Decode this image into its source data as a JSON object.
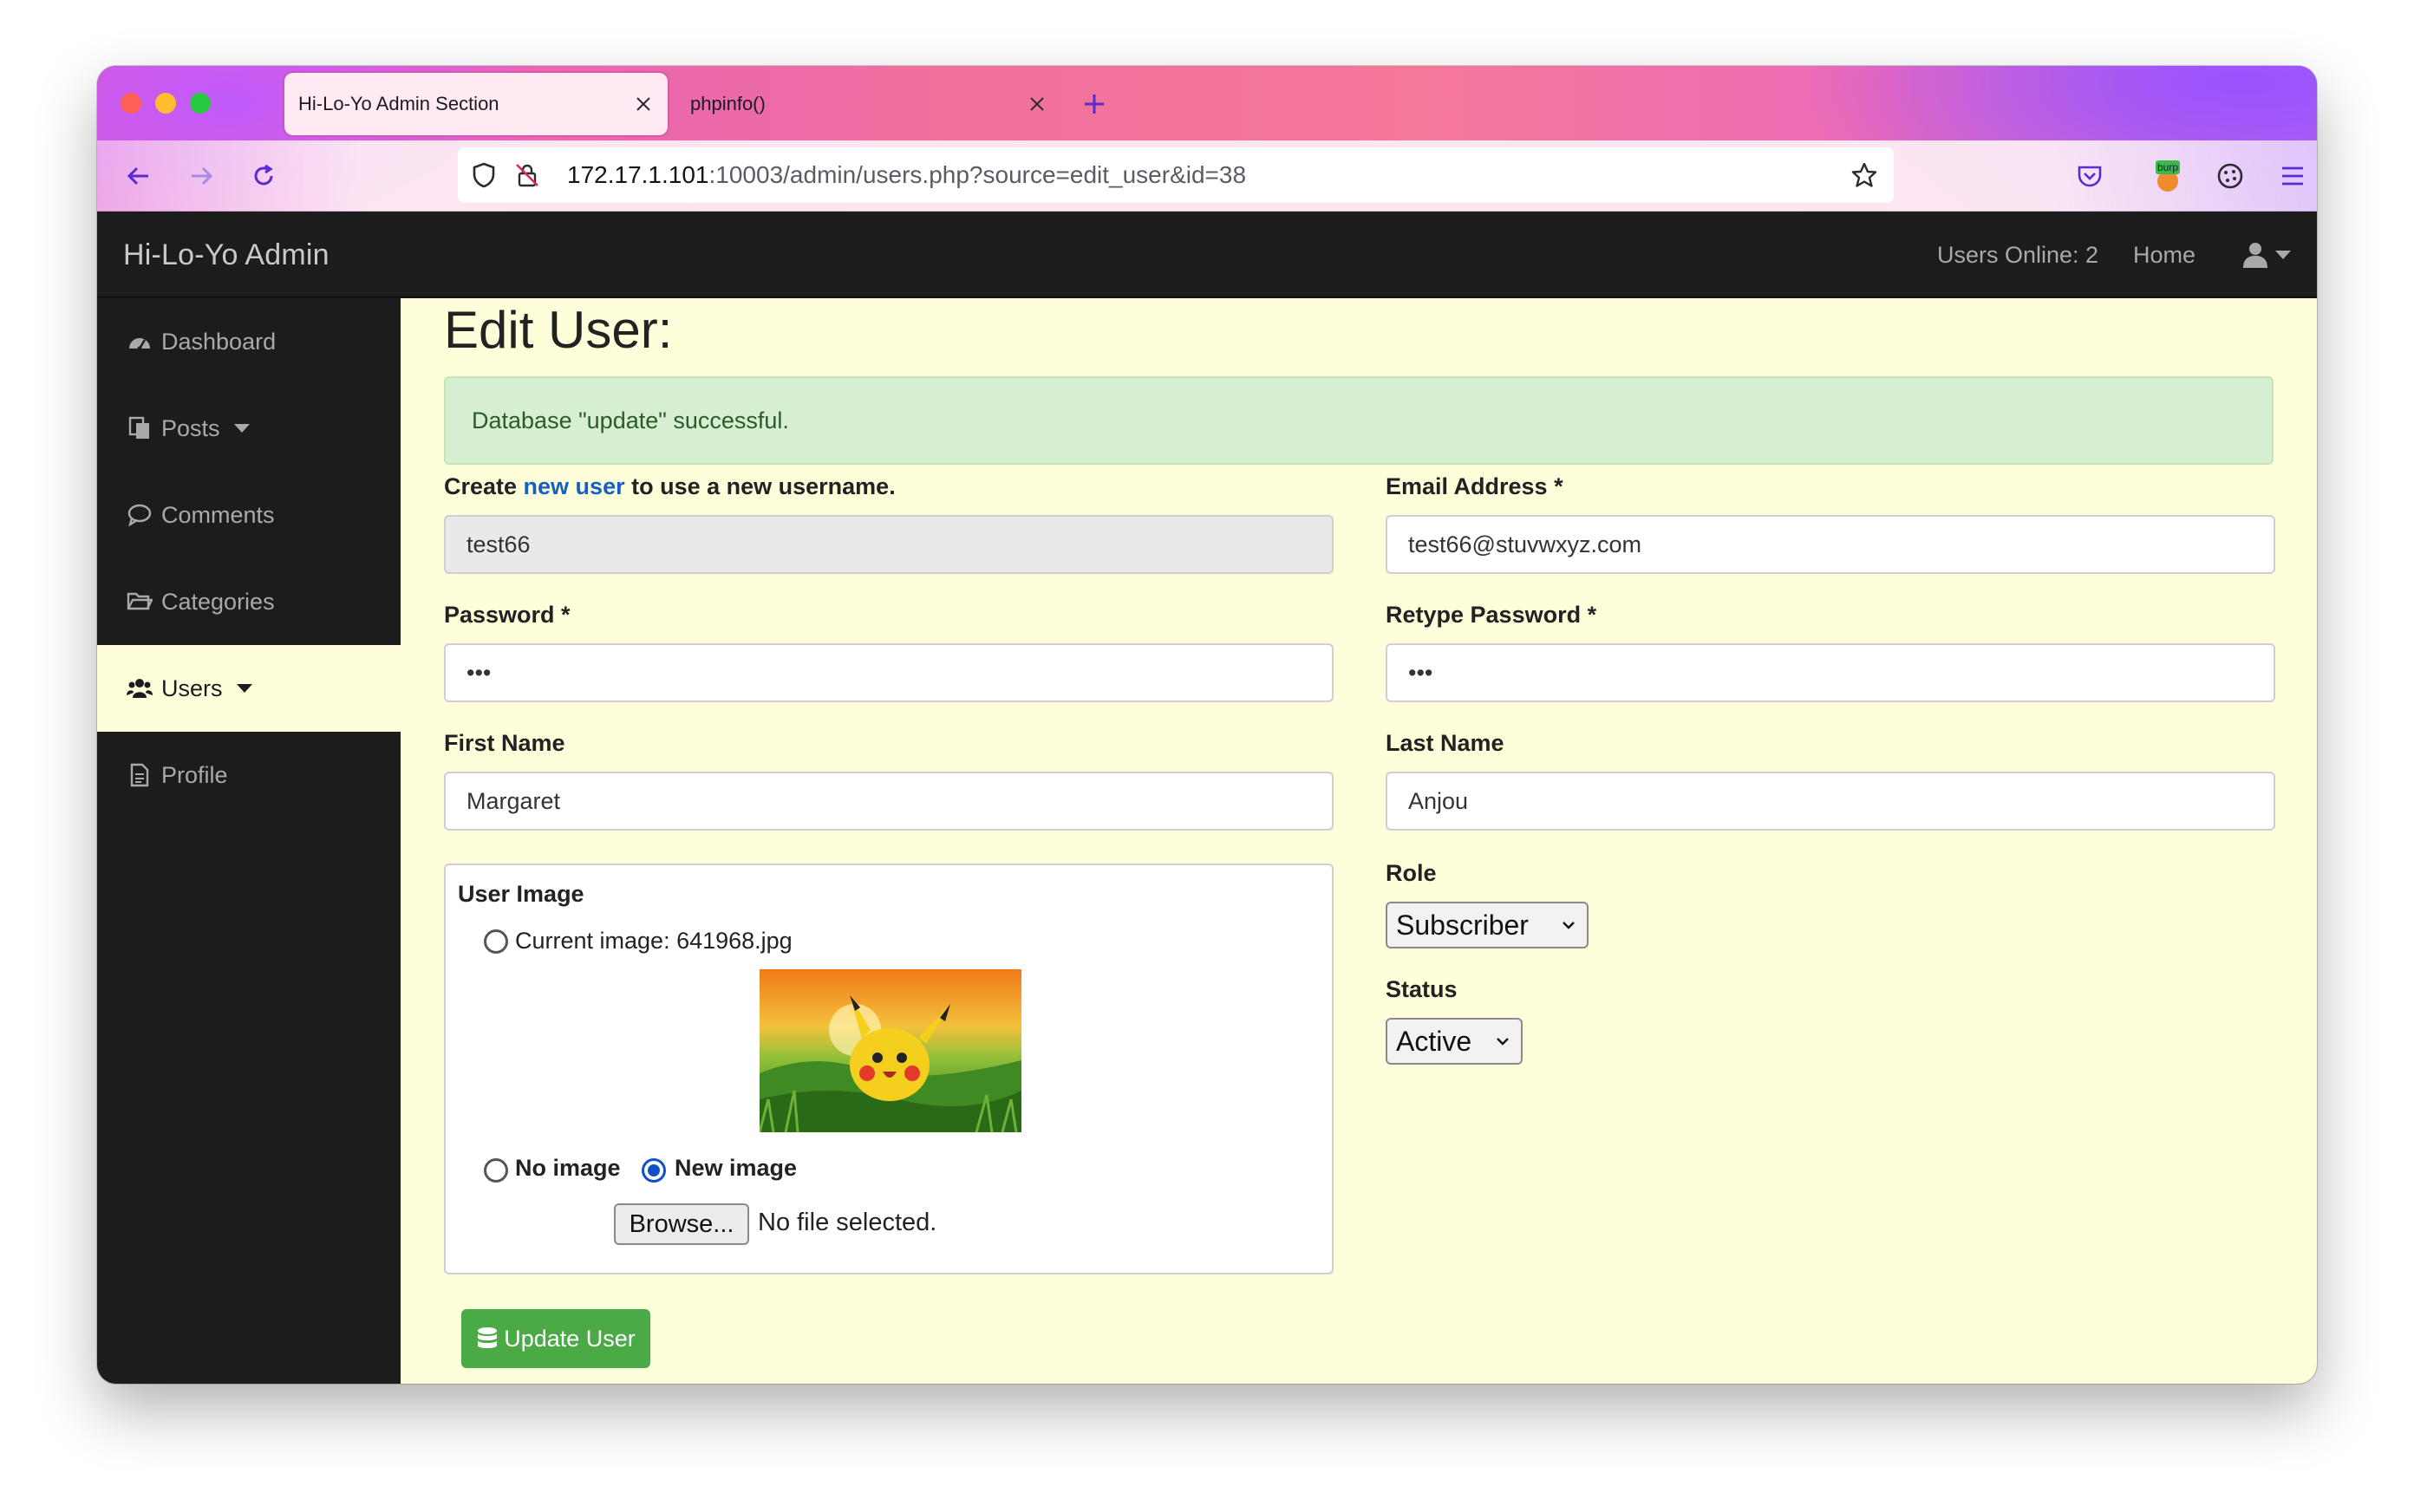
{
  "browser": {
    "tabs": [
      {
        "title": "Hi-Lo-Yo Admin Section",
        "active": true
      },
      {
        "title": "phpinfo()",
        "active": false
      }
    ],
    "url": {
      "host": "172.17.1.101",
      "rest": ":10003/admin/users.php?source=edit_user&id=38"
    },
    "extensions": [
      "pocket-icon",
      "burp-icon",
      "cookie-icon",
      "menu-icon"
    ],
    "burp_badge": "burp"
  },
  "topnav": {
    "brand": "Hi-Lo-Yo Admin",
    "users_online": "Users Online: 2",
    "home": "Home"
  },
  "sidebar": {
    "items": [
      {
        "label": "Dashboard",
        "icon": "dashboard-icon"
      },
      {
        "label": "Posts",
        "icon": "posts-icon",
        "dropdown": true
      },
      {
        "label": "Comments",
        "icon": "comment-icon"
      },
      {
        "label": "Categories",
        "icon": "folder-icon"
      },
      {
        "label": "Users",
        "icon": "users-icon",
        "dropdown": true,
        "active": true
      },
      {
        "label": "Profile",
        "icon": "profile-icon"
      }
    ]
  },
  "main": {
    "title": "Edit User:",
    "alert": "Database \"update\" successful.",
    "username_label": {
      "before": "Create ",
      "link": "new user",
      "after": " to use a new username."
    },
    "username_value": "test66",
    "email_label": "Email Address *",
    "email_value": "test66@stuvwxyz.com",
    "password_label": "Password *",
    "password_value": "•••",
    "retype_label": "Retype Password *",
    "retype_value": "•••",
    "first_name_label": "First Name",
    "first_name_value": "Margaret",
    "last_name_label": "Last Name",
    "last_name_value": "Anjou",
    "user_image": {
      "legend": "User Image",
      "current_label": "Current image: 641968.jpg",
      "no_image_label": "No image",
      "new_image_label": "New image",
      "selected": "new",
      "browse_label": "Browse...",
      "file_status": "No file selected."
    },
    "role_label": "Role",
    "role_value": "Subscriber",
    "status_label": "Status",
    "status_value": "Active",
    "submit_label": "Update User"
  },
  "colors": {
    "page_bg": "#fefedb",
    "nav_bg": "#1c1c1c",
    "alert_bg": "#d6efd0",
    "alert_text": "#2b5b2b",
    "link": "#1660c2",
    "submit_bg": "#4aaa46",
    "radio_selected": "#1250c8"
  }
}
